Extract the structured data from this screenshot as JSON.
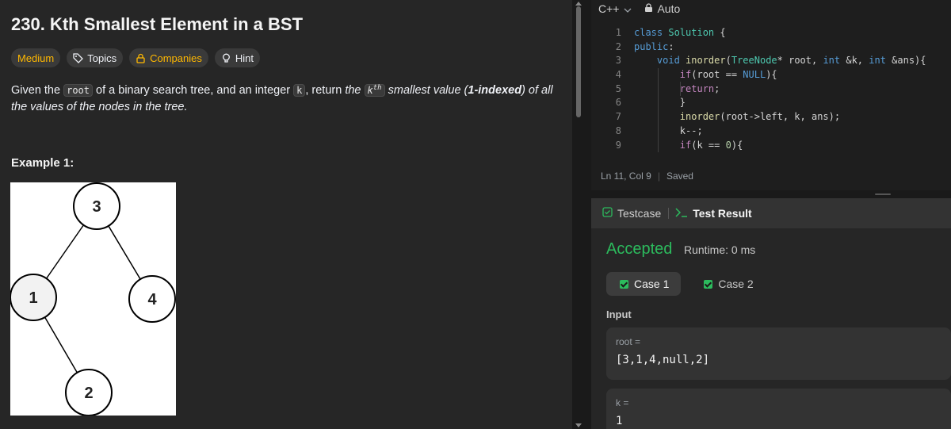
{
  "problem": {
    "title": "230. Kth Smallest Element in a BST",
    "difficulty": "Medium",
    "topics_label": "Topics",
    "companies_label": "Companies",
    "hint_label": "Hint",
    "desc_given": "Given the",
    "desc_root": "root",
    "desc_mid": "of a binary search tree, and an integer",
    "desc_k": "k",
    "desc_return": ", return",
    "desc_the": "the",
    "desc_kth": "k",
    "desc_th": "th",
    "desc_smallest": "smallest value (",
    "desc_indexed": "1-indexed",
    "desc_rest": ") of all the values of the nodes in the tree.",
    "example_title": "Example 1:",
    "tree_nodes": [
      "3",
      "1",
      "4",
      "2"
    ]
  },
  "editor": {
    "language": "C++",
    "mode": "Auto",
    "status_position": "Ln 11, Col 9",
    "status_saved": "Saved",
    "line_numbers": [
      "1",
      "2",
      "3",
      "4",
      "5",
      "6",
      "7",
      "8",
      "9"
    ]
  },
  "result": {
    "tab_testcase": "Testcase",
    "tab_result": "Test Result",
    "verdict": "Accepted",
    "runtime": "Runtime: 0 ms",
    "cases": [
      "Case 1",
      "Case 2"
    ],
    "input_label": "Input",
    "var1_name": "root =",
    "var1_value": "[3,1,4,null,2]",
    "var2_name": "k =",
    "var2_value": "1"
  },
  "colors": {
    "accepted": "#2cbb5d",
    "medium": "#ffb800",
    "background": "#1a1a1a"
  }
}
